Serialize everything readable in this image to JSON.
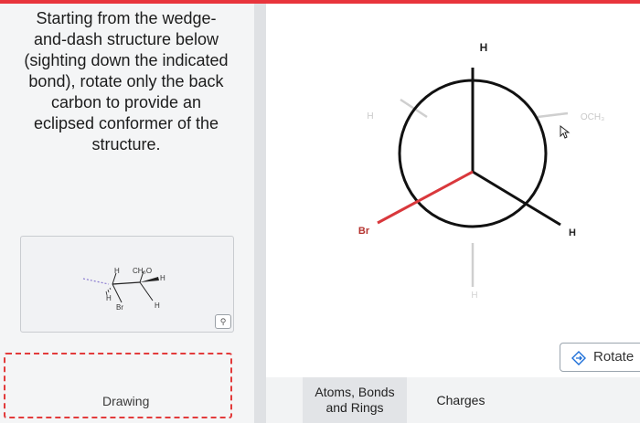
{
  "question": {
    "lines": [
      "Starting from the wedge-",
      "and-dash structure below",
      "(sighting down the indicated",
      "bond), rotate only the back",
      "carbon to provide an",
      "eclipsed conformer of the",
      "structure."
    ]
  },
  "thumbnail": {
    "labels": [
      "H",
      "CH₃O",
      "H",
      "H",
      "Br",
      "H"
    ]
  },
  "drawing_label": "Drawing",
  "newman": {
    "front_top": "H",
    "front_left": "Br",
    "front_right": "H",
    "back_left": "H",
    "back_right": "OCH₃",
    "back_bottom": "H"
  },
  "rotate_label": "Rotate",
  "tabs": {
    "atoms": [
      "Atoms, Bonds",
      "and Rings"
    ],
    "charges": "Charges"
  },
  "colors": {
    "accent_red": "#e8343c",
    "bond_red": "#d9383c"
  },
  "icons": [
    "zoom-icon",
    "rotate-icon",
    "cursor-icon"
  ]
}
